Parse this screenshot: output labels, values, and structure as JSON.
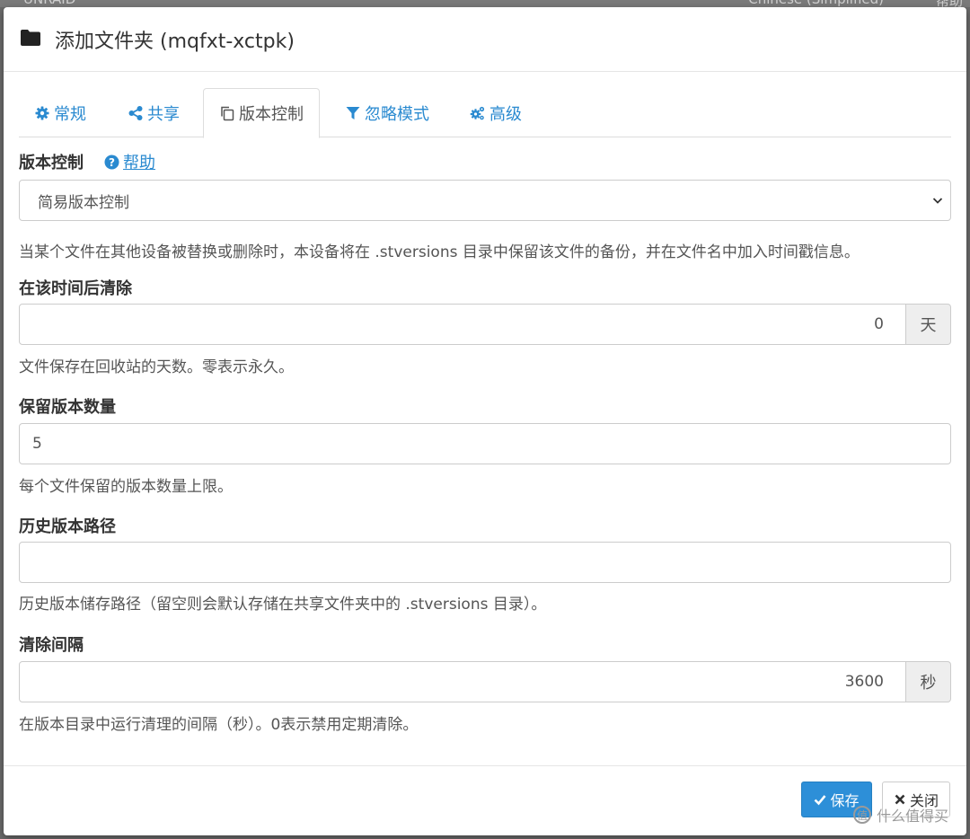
{
  "background": {
    "brand": "UNRAID",
    "language": "Chinese (Simplified)",
    "help": "帮助"
  },
  "modal": {
    "title": "添加文件夹 (mqfxt-xctpk)",
    "tabs": [
      {
        "label": "常规",
        "icon": "gear-icon"
      },
      {
        "label": "共享",
        "icon": "share-icon"
      },
      {
        "label": "版本控制",
        "icon": "copy-icon",
        "active": true
      },
      {
        "label": "忽略模式",
        "icon": "filter-icon"
      },
      {
        "label": "高级",
        "icon": "cogs-icon"
      }
    ],
    "versioning": {
      "label": "版本控制",
      "help": "帮助",
      "selected": "简易版本控制",
      "description": "当某个文件在其他设备被替换或删除时，本设备将在 .stversions 目录中保留该文件的备份，并在文件名中加入时间戳信息。"
    },
    "clean_after": {
      "label": "在该时间后清除",
      "value": "0",
      "unit": "天",
      "hint": "文件保存在回收站的天数。零表示永久。"
    },
    "keep_versions": {
      "label": "保留版本数量",
      "value": "5",
      "hint": "每个文件保留的版本数量上限。"
    },
    "versions_path": {
      "label": "历史版本路径",
      "value": "",
      "hint": "历史版本储存路径（留空则会默认存储在共享文件夹中的 .stversions 目录）。"
    },
    "cleanup_interval": {
      "label": "清除间隔",
      "value": "3600",
      "unit": "秒",
      "hint": "在版本目录中运行清理的间隔（秒）。0表示禁用定期清除。"
    },
    "buttons": {
      "save": "保存",
      "close": "关闭"
    }
  },
  "watermark": "什么值得买",
  "colors": {
    "link": "#2a8ad0",
    "primary_button": "#2d8fd8"
  }
}
